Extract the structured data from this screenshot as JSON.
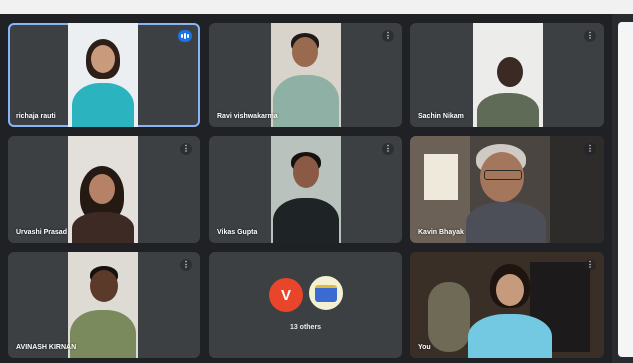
{
  "participants": [
    {
      "name": "richaja rauti",
      "speaking": true
    },
    {
      "name": "Ravi vishwakarma"
    },
    {
      "name": "Sachin Nikam"
    },
    {
      "name": "Urvashi Prasad"
    },
    {
      "name": "Vikas Gupta"
    },
    {
      "name": "Kavin Bhayak"
    },
    {
      "name": "AVINASH KIRNAN"
    },
    {
      "name": "You"
    }
  ],
  "others": {
    "avatar_letter": "V",
    "avatar_color": "#e8452b",
    "label": "13 others"
  },
  "icons": {
    "more_options": "⋮",
    "speaking": "audio-level-icon"
  },
  "colors": {
    "background": "#202124",
    "tile": "#3c4043",
    "active_outline": "#8ab4f8"
  }
}
